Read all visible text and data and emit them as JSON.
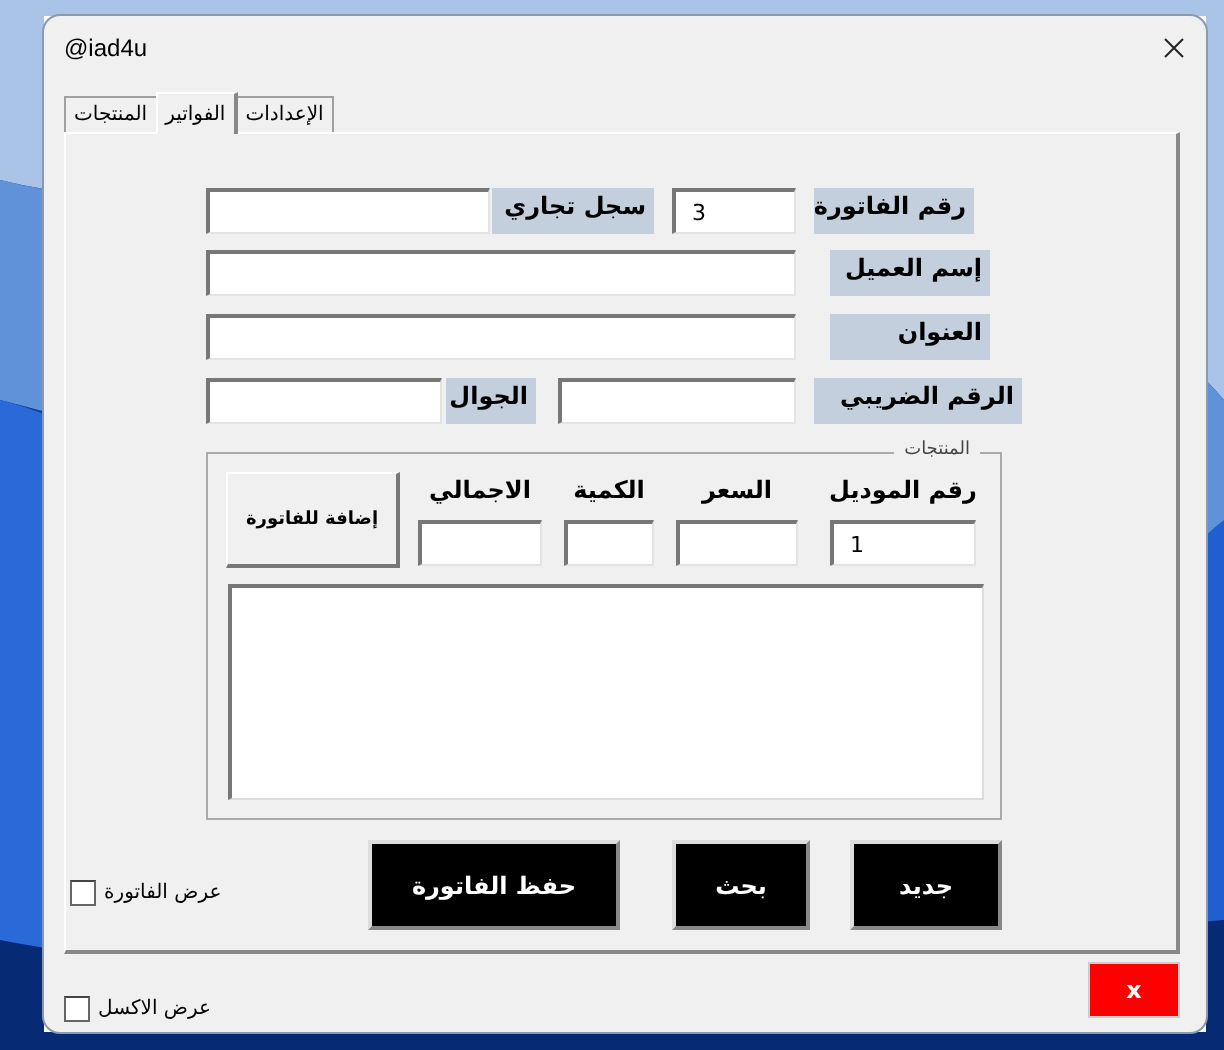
{
  "window": {
    "title": "@iad4u"
  },
  "tabs": [
    {
      "label": "الإعدادات",
      "selected": false
    },
    {
      "label": "الفواتير",
      "selected": true
    },
    {
      "label": "المنتجات",
      "selected": false
    }
  ],
  "form_rows": [
    [
      {
        "kind": "label",
        "text": "رقم الفاتورة"
      },
      {
        "kind": "field",
        "value": "3"
      },
      {
        "kind": "label",
        "text": "سجل تجاري"
      },
      {
        "kind": "field"
      }
    ],
    [
      {
        "kind": "label",
        "text": "إسم العميل"
      },
      {
        "kind": "field"
      }
    ],
    [
      {
        "kind": "label",
        "text": "العنوان"
      },
      {
        "kind": "field"
      }
    ],
    [
      {
        "kind": "label",
        "text": "الرقم الضريبي"
      },
      {
        "kind": "field"
      },
      {
        "kind": "label",
        "text": "الجوال"
      },
      {
        "kind": "field"
      }
    ]
  ],
  "products": {
    "legend": "المنتجات",
    "add_button": "إضافة للفاتورة",
    "columns": [
      {
        "header": "رقم الموديل",
        "value": "1"
      },
      {
        "header": "السعر"
      },
      {
        "header": "الكمية"
      },
      {
        "header": "الاجمالي"
      }
    ]
  },
  "buttons": [
    {
      "label": "جديد"
    },
    {
      "label": "بحث"
    },
    {
      "label": "حفظ الفاتورة"
    }
  ],
  "show_invoice": {
    "label": "عرض الفاتورة",
    "checked": false
  },
  "show_excel": {
    "label": "عرض الاكسل",
    "checked": false
  },
  "close_button": {
    "label": "x"
  }
}
